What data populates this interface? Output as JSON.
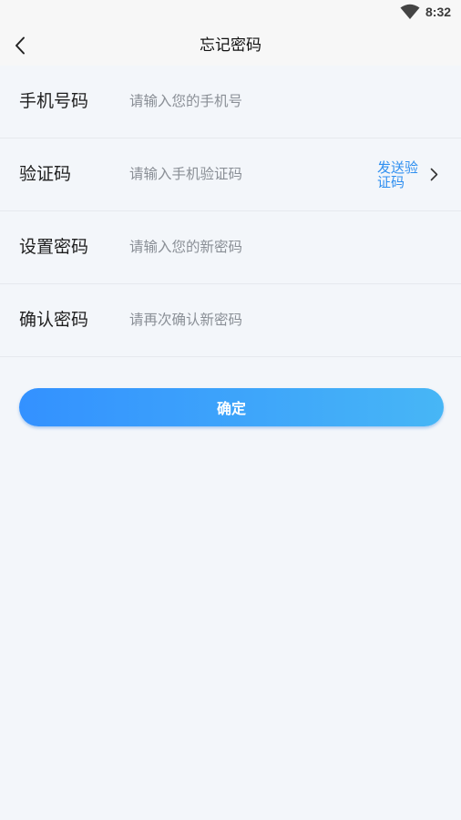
{
  "status_bar": {
    "time": "8:32",
    "wifi_icon": "wifi-icon"
  },
  "header": {
    "back_icon": "chevron-left-icon",
    "title": "忘记密码"
  },
  "form": {
    "phone": {
      "label": "手机号码",
      "placeholder": "请输入您的手机号",
      "value": ""
    },
    "code": {
      "label": "验证码",
      "placeholder": "请输入手机验证码",
      "value": "",
      "send_label": "发送验证码",
      "send_icon": "chevron-right-icon"
    },
    "new_password": {
      "label": "设置密码",
      "placeholder": "请输入您的新密码",
      "value": ""
    },
    "confirm_password": {
      "label": "确认密码",
      "placeholder": "请再次确认新密码",
      "value": ""
    }
  },
  "confirm_button": {
    "label": "确定"
  },
  "colors": {
    "accent": "#2f8ff0",
    "button_gradient_start": "#3391ff",
    "button_gradient_end": "#47b6f6",
    "background": "#f3f6fa",
    "bar_background": "#f7f7f7"
  }
}
